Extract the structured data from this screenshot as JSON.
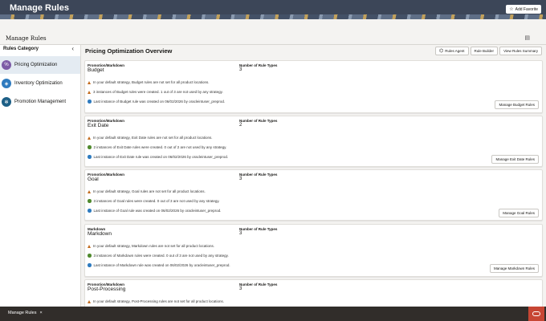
{
  "app": {
    "title": "Manage Rules",
    "add_favorite": "Add Favorite"
  },
  "page": {
    "title": "Manage Rules"
  },
  "left_panel": {
    "header": "Rules Category",
    "items": [
      {
        "label": "Pricing Optimization",
        "icon": "price-tag-icon",
        "color": "#7c5ba6"
      },
      {
        "label": "Inventory Optimization",
        "icon": "inventory-icon",
        "color": "#2f7bbf"
      },
      {
        "label": "Promotion Management",
        "icon": "promotion-gear-icon",
        "color": "#1d5f86"
      }
    ]
  },
  "main": {
    "title": "Pricing Optimization Overview",
    "toolbar": {
      "rules_agent": "Rules Agent",
      "rule_builder": "Rule Builder",
      "view_summary": "View Rules Summary"
    },
    "nrt_label": "Number of Rule Types",
    "cards": [
      {
        "category": "Promotion/Markdown",
        "name": "Budget",
        "count": "3",
        "lines": [
          {
            "type": "warn",
            "text": "In your default strategy, Budget rules are not set for all product locations."
          },
          {
            "type": "warn",
            "text": "3 instances of Budget rules were created. 1 out of 3 are not used by any strategy."
          },
          {
            "type": "info",
            "text": "Last instance of Budget rule was created on 06/02/2026 by oracleintuser_preprod."
          }
        ],
        "button": "Manage Budget Rules"
      },
      {
        "category": "Promotion/Markdown",
        "name": "Exit Date",
        "count": "2",
        "lines": [
          {
            "type": "warn",
            "text": "In your default strategy, Exit Date rules are not set for all product locations."
          },
          {
            "type": "ok",
            "text": "2 instances of Exit Date rules were created. 0 out of 2 are not used by any strategy."
          },
          {
            "type": "info",
            "text": "Last instance of Exit Date rule was created on 06/02/2026 by oracleintuser_preprod."
          }
        ],
        "button": "Manage Exit Date Rules"
      },
      {
        "category": "Promotion/Markdown",
        "name": "Goal",
        "count": "3",
        "lines": [
          {
            "type": "warn",
            "text": "In your default strategy, Goal rules are not set for all product locations."
          },
          {
            "type": "ok",
            "text": "3 instances of Goal rules were created. 0 out of 3 are not used by any strategy."
          },
          {
            "type": "info",
            "text": "Last instance of Goal rule was created on 06/02/2026 by oracleintuser_preprod."
          }
        ],
        "button": "Manage Goal Rules"
      },
      {
        "category": "Markdown",
        "name": "Markdown",
        "count": "3",
        "lines": [
          {
            "type": "warn",
            "text": "In your default strategy, Markdown rules are not set for all product locations."
          },
          {
            "type": "ok",
            "text": "3 instances of Markdown rules were created. 0 out of 3 are not used by any strategy."
          },
          {
            "type": "info",
            "text": "Last instance of Markdown rule was created on 06/02/2026 by oracleintuser_preprod."
          }
        ],
        "button": "Manage Markdown Rules"
      },
      {
        "category": "Promotion/Markdown",
        "name": "Post-Processing",
        "count": "3",
        "lines": [
          {
            "type": "warn",
            "text": "In your default strategy, Post-Processing rules are not set for all product locations."
          }
        ],
        "button": ""
      }
    ]
  },
  "footer": {
    "tab_label": "Manage Rules",
    "close": "×"
  }
}
